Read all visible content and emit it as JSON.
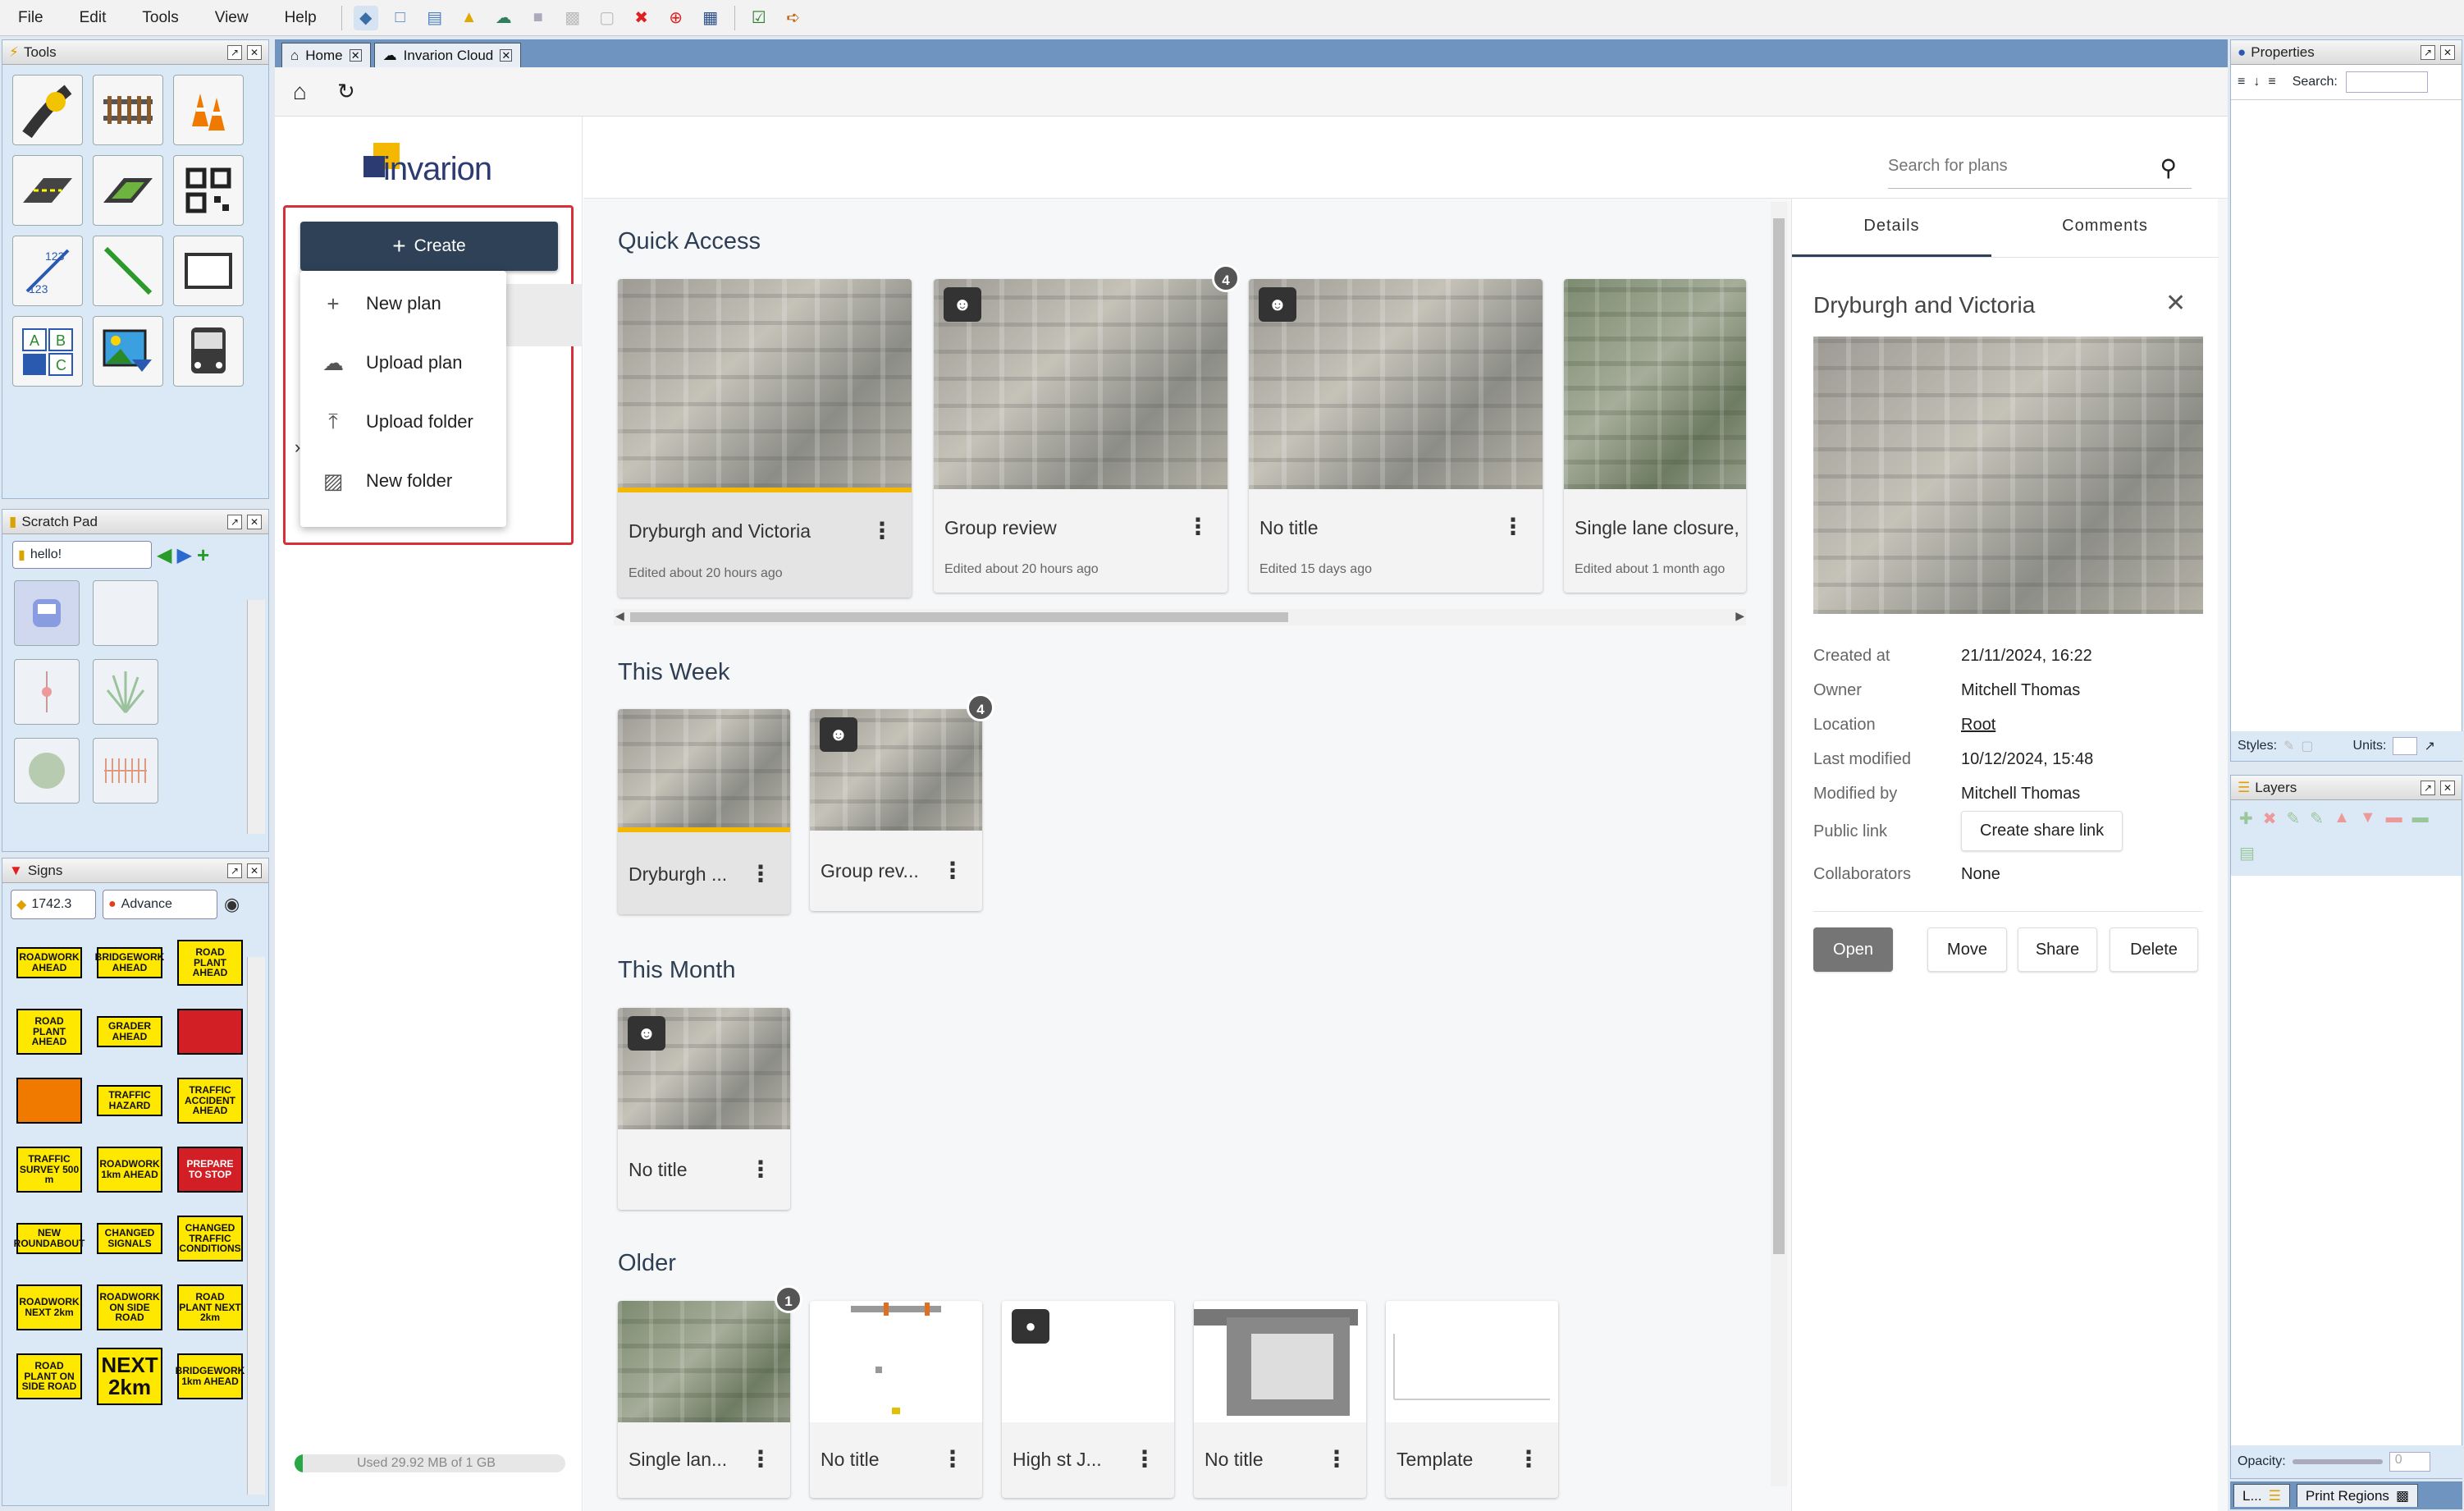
{
  "menubar": {
    "items": [
      "File",
      "Edit",
      "Tools",
      "View",
      "Help"
    ]
  },
  "toolbar_icons": [
    "map-icon",
    "new-file-icon",
    "open-file-icon",
    "import-icon",
    "cloud-icon",
    "save-icon",
    "print-icon",
    "export-icon",
    "close-red-icon",
    "target-red-icon",
    "calendar-icon",
    "checkbox-icon",
    "exit-icon"
  ],
  "panels": {
    "tools": {
      "title": "Tools"
    },
    "scratch": {
      "title": "Scratch Pad",
      "search_value": "hello!"
    },
    "signs": {
      "title": "Signs",
      "value_field": "1742.3",
      "advance_label": "Advance"
    },
    "properties": {
      "title": "Properties",
      "search_label": "Search:",
      "styles_label": "Styles:",
      "units_label": "Units:"
    },
    "layers": {
      "title": "Layers",
      "opacity_label": "Opacity:",
      "opacity_value": "0"
    },
    "bottom": {
      "l_tab": "L...",
      "print_regions": "Print Regions"
    }
  },
  "tabs": [
    {
      "label": "Home"
    },
    {
      "label": "Invarion Cloud"
    }
  ],
  "brand": {
    "logo_text": "invarion"
  },
  "search": {
    "placeholder": "Search for plans"
  },
  "create": {
    "button_label": "Create",
    "menu": [
      {
        "label": "New plan",
        "icon": "plus-icon"
      },
      {
        "label": "Upload plan",
        "icon": "cloud-upload-icon"
      },
      {
        "label": "Upload folder",
        "icon": "upload-icon"
      },
      {
        "label": "New folder",
        "icon": "folder-plus-icon"
      }
    ]
  },
  "storage": {
    "text": "Used 29.92 MB of 1 GB",
    "fraction": 0.03
  },
  "sections": {
    "quick_access": {
      "title": "Quick Access",
      "cards": [
        {
          "title": "Dryburgh and Victoria",
          "meta": "Edited about 20 hours ago"
        },
        {
          "title": "Group review",
          "meta": "Edited about 20 hours ago",
          "badge": "4"
        },
        {
          "title": "No title",
          "meta": "Edited 15 days ago"
        },
        {
          "title": "Single lane closure,",
          "meta": "Edited about 1 month ago"
        }
      ]
    },
    "this_week": {
      "title": "This Week",
      "cards": [
        {
          "title": "Dryburgh ..."
        },
        {
          "title": "Group rev...",
          "badge": "4"
        }
      ]
    },
    "this_month": {
      "title": "This Month",
      "cards": [
        {
          "title": "No title"
        }
      ]
    },
    "older": {
      "title": "Older",
      "cards": [
        {
          "title": "Single lan...",
          "badge": "1"
        },
        {
          "title": "No title"
        },
        {
          "title": "High st J..."
        },
        {
          "title": "No title"
        },
        {
          "title": "Template"
        }
      ]
    }
  },
  "details": {
    "tabs": [
      "Details",
      "Comments"
    ],
    "title": "Dryburgh and Victoria",
    "rows": [
      {
        "label": "Created at",
        "value": "21/11/2024, 16:22"
      },
      {
        "label": "Owner",
        "value": "Mitchell Thomas"
      },
      {
        "label": "Location",
        "value": "Root"
      },
      {
        "label": "Last modified",
        "value": "10/12/2024, 15:48"
      },
      {
        "label": "Modified by",
        "value": "Mitchell Thomas"
      },
      {
        "label": "Public link",
        "value": "Create share link"
      },
      {
        "label": "Collaborators",
        "value": "None"
      }
    ],
    "actions": [
      "Open",
      "Move",
      "Share",
      "Delete"
    ]
  },
  "signs": [
    "ROADWORK AHEAD",
    "BRIDGEWORK AHEAD",
    "ROAD PLANT AHEAD",
    "ROAD PLANT AHEAD",
    "GRADER AHEAD",
    "",
    "",
    "TRAFFIC HAZARD",
    "TRAFFIC ACCIDENT AHEAD",
    "TRAFFIC SURVEY 500 m",
    "ROADWORK 1km AHEAD",
    "PREPARE TO STOP",
    "NEW ROUNDABOUT",
    "CHANGED SIGNALS",
    "CHANGED TRAFFIC CONDITIONS",
    "ROADWORK NEXT 2km",
    "ROADWORK ON SIDE ROAD",
    "ROAD PLANT NEXT 2km",
    "ROAD PLANT ON SIDE ROAD",
    "NEXT 2km",
    "BRIDGEWORK 1km AHEAD"
  ],
  "colors": {
    "accent_dark": "#2f4156",
    "highlight_red": "#d8303a",
    "selected_bar": "#f5b800",
    "dock_blue": "#dbe8f6"
  }
}
